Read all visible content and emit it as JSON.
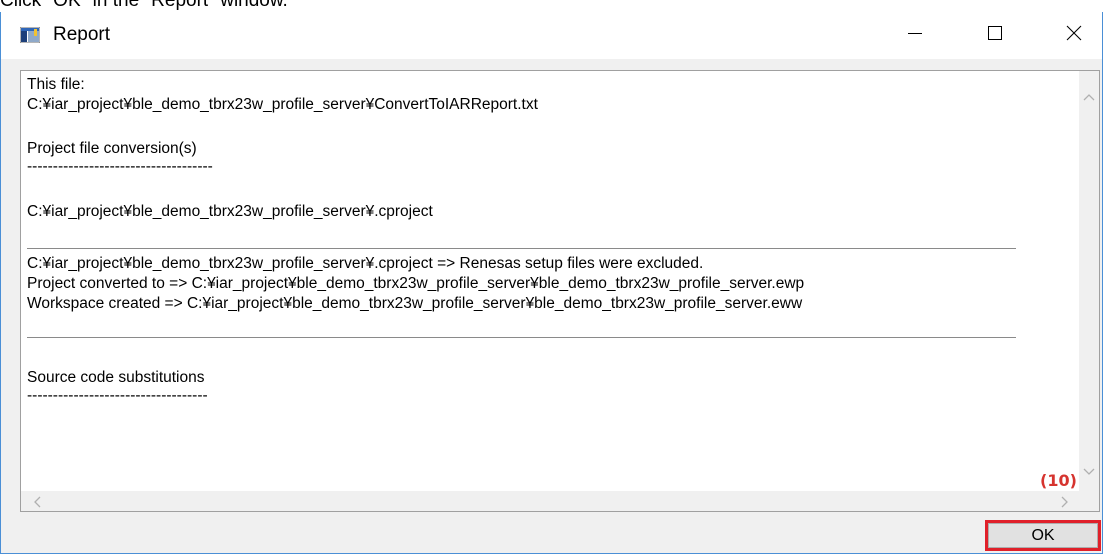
{
  "instruction": "Click \"OK\" in the \"Report\" window.",
  "window": {
    "title": "Report",
    "icon": "app-window-icon",
    "controls": {
      "minimize": "minimize-icon",
      "maximize": "maximize-icon",
      "close": "close-icon"
    }
  },
  "report": {
    "lines": [
      "This file:",
      "C:¥iar_project¥ble_demo_tbrx23w_profile_server¥ConvertToIARReport.txt",
      "Project file conversion(s)",
      "------------------------------------",
      "C:¥iar_project¥ble_demo_tbrx23w_profile_server¥.cproject",
      "C:¥iar_project¥ble_demo_tbrx23w_profile_server¥.cproject => Renesas setup files were excluded.",
      "Project converted to => C:¥iar_project¥ble_demo_tbrx23w_profile_server¥ble_demo_tbrx23w_profile_server.ewp",
      "Workspace created => C:¥iar_project¥ble_demo_tbrx23w_profile_server¥ble_demo_tbrx23w_profile_server.eww",
      "Source code substitutions",
      "-----------------------------------"
    ]
  },
  "annotation": {
    "step": "(10)",
    "color": "#e0202a"
  },
  "buttons": {
    "ok": "OK"
  }
}
